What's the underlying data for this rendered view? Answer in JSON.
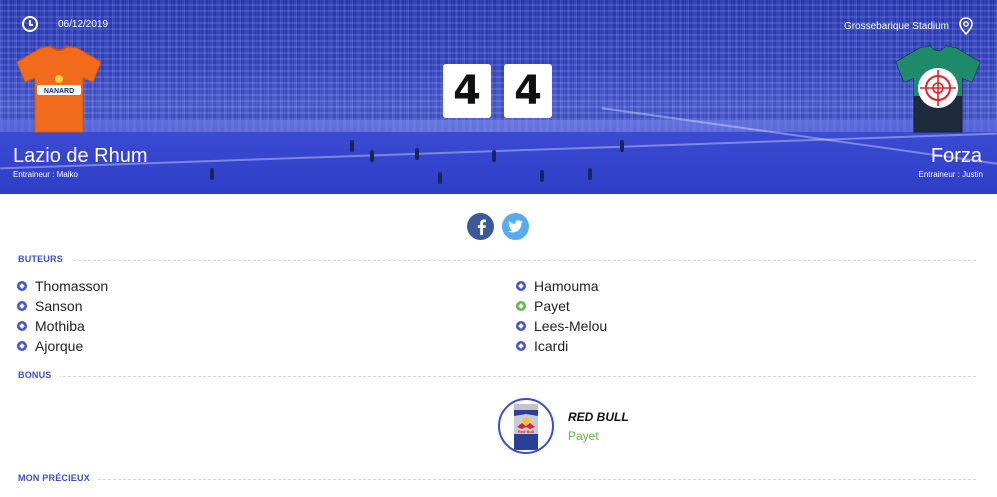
{
  "match": {
    "date": "06/12/2019",
    "stadium": "Grossebarique Stadium",
    "home": {
      "name": "Lazio de Rhum",
      "coach": "Entraineur : Malko",
      "sponsor": "NANARD",
      "score": "4"
    },
    "away": {
      "name": "Forza",
      "coach": "Entraineur : Justin",
      "score": "4"
    }
  },
  "icons": {
    "date": "clock-icon",
    "stadium": "location-pin-icon",
    "facebook": "facebook-icon",
    "twitter": "twitter-icon",
    "goal": "soccer-ball-icon"
  },
  "colors": {
    "accent": "#3a4fc8",
    "facebook": "#3b5998",
    "twitter": "#55acee",
    "home_jersey": "#f26a1b",
    "away_jersey": "#1e8a6a",
    "highlight": "#5cbb4a"
  },
  "sections": {
    "scorers": "BUTEURS",
    "bonus": "BONUS",
    "precious": "MON PRÉCIEUX"
  },
  "scorers": {
    "home": [
      "Thomasson",
      "Sanson",
      "Mothiba",
      "Ajorque"
    ],
    "away": [
      "Hamouma",
      "Payet",
      "Lees-Melou",
      "Icardi"
    ]
  },
  "bonus": {
    "name": "RED BULL",
    "player": "Payet",
    "image_text": "Red Bull"
  }
}
